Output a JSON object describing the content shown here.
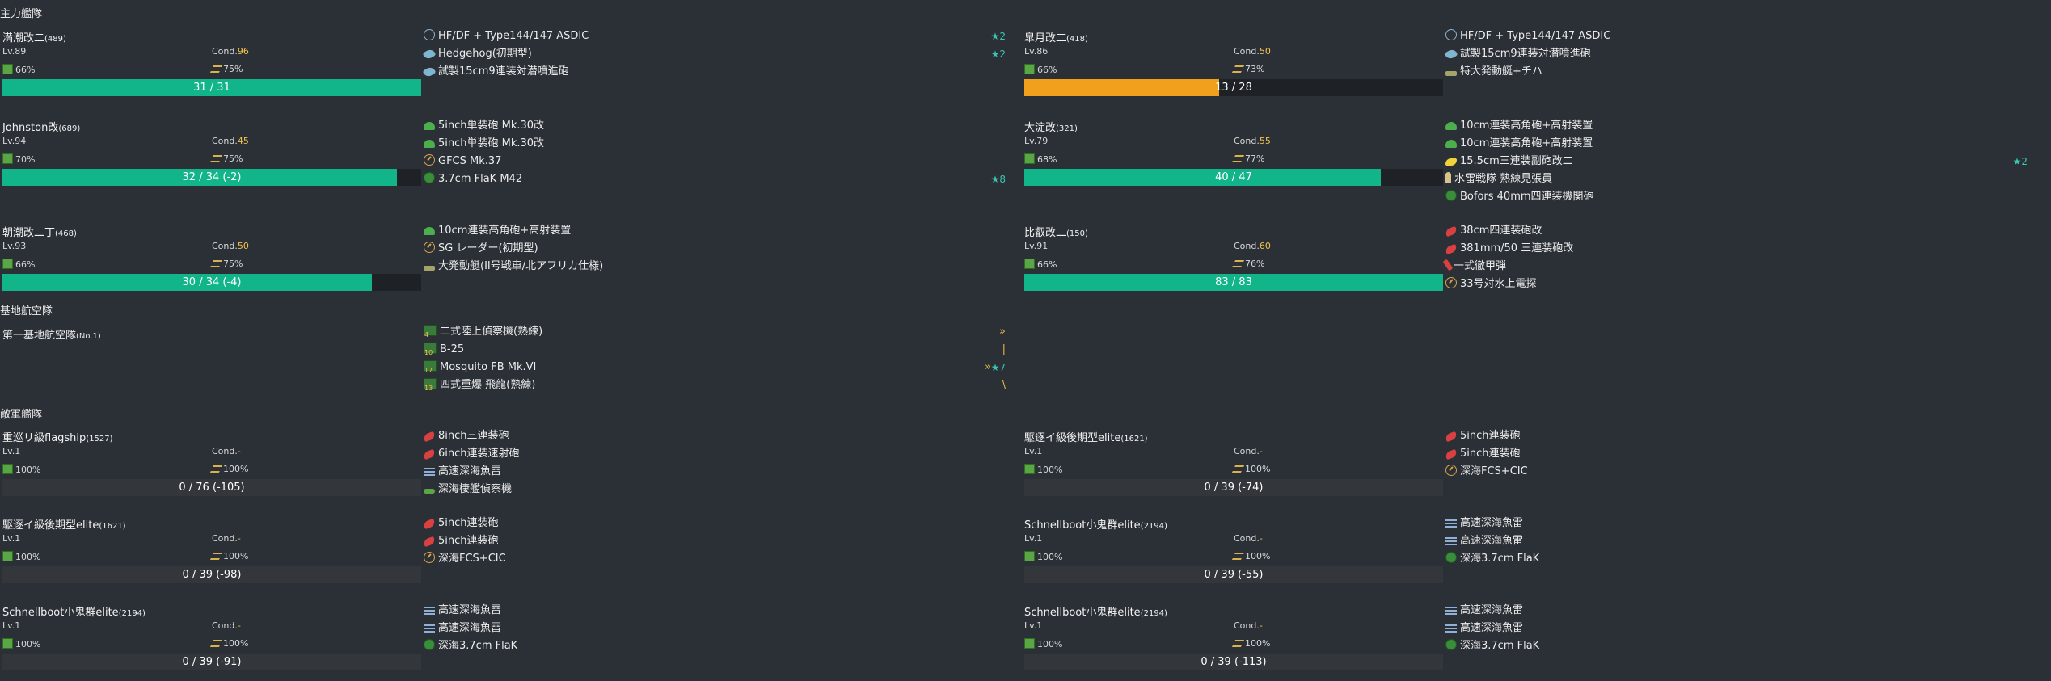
{
  "sections": {
    "main_fleet": "主力艦隊",
    "land_base": "基地航空隊",
    "enemy_fleet": "敵軍艦隊"
  },
  "colors": {
    "green": "#12b58a",
    "orange": "#f0a01c",
    "track": "#1e2125",
    "enemy_track": "#33373c"
  },
  "ships": [
    {
      "name": "満潮改二",
      "id": "(489)",
      "lv": "Lv.89",
      "cond_label": "Cond.",
      "cond": "96",
      "fuel": "66%",
      "ammo": "75%",
      "hp": "31 / 31",
      "hp_ratio": 1.0,
      "bar": "green",
      "equips": [
        {
          "icon": "sonar-icon",
          "name": "HF/DF + Type144/147 ASDIC",
          "imp": "★2"
        },
        {
          "icon": "depth-charge-icon",
          "name": "Hedgehog(初期型)",
          "imp": "★2"
        },
        {
          "icon": "depth-charge-icon",
          "name": "試製15cm9連装対潜噴進砲",
          "imp": ""
        }
      ]
    },
    {
      "name": "皐月改二",
      "id": "(418)",
      "lv": "Lv.86",
      "cond_label": "Cond.",
      "cond": "50",
      "fuel": "66%",
      "ammo": "73%",
      "hp": "13 / 28",
      "hp_ratio": 0.4643,
      "bar": "orange",
      "equips": [
        {
          "icon": "sonar-icon",
          "name": "HF/DF + Type144/147 ASDIC",
          "imp": ""
        },
        {
          "icon": "depth-charge-icon",
          "name": "試製15cm9連装対潜噴進砲",
          "imp": ""
        },
        {
          "icon": "landing-craft-icon",
          "name": "特大発動艇+チハ",
          "imp": ""
        }
      ]
    },
    {
      "name": "Johnston改",
      "id": "(689)",
      "lv": "Lv.94",
      "cond_label": "Cond.",
      "cond": "45",
      "fuel": "70%",
      "ammo": "75%",
      "hp": "32 / 34 (-2)",
      "hp_ratio": 0.9412,
      "bar": "green",
      "equips": [
        {
          "icon": "small-gun-icon",
          "name": "5inch単装砲 Mk.30改",
          "imp": ""
        },
        {
          "icon": "small-gun-icon",
          "name": "5inch単装砲 Mk.30改",
          "imp": ""
        },
        {
          "icon": "radar-icon",
          "name": "GFCS Mk.37",
          "imp": ""
        },
        {
          "icon": "aa-gun-icon",
          "name": "3.7cm FlaK M42",
          "imp": "★8"
        }
      ]
    },
    {
      "name": "大淀改",
      "id": "(321)",
      "lv": "Lv.79",
      "cond_label": "Cond.",
      "cond": "55",
      "fuel": "68%",
      "ammo": "77%",
      "hp": "40 / 47",
      "hp_ratio": 0.8511,
      "bar": "green",
      "equips": [
        {
          "icon": "small-gun-icon",
          "name": "10cm連装高角砲+高射装置",
          "imp": ""
        },
        {
          "icon": "small-gun-icon",
          "name": "10cm連装高角砲+高射装置",
          "imp": ""
        },
        {
          "icon": "secondary-gun-icon",
          "name": "15.5cm三連装副砲改二",
          "imp": "★2"
        },
        {
          "icon": "lookout-icon",
          "name": "水雷戦隊 熟練見張員",
          "imp": ""
        },
        {
          "icon": "aa-gun-icon",
          "name": "Bofors 40mm四連装機関砲",
          "imp": ""
        }
      ]
    },
    {
      "name": "朝潮改二丁",
      "id": "(468)",
      "lv": "Lv.93",
      "cond_label": "Cond.",
      "cond": "50",
      "fuel": "66%",
      "ammo": "75%",
      "hp": "30 / 34 (-4)",
      "hp_ratio": 0.8824,
      "bar": "green",
      "equips": [
        {
          "icon": "small-gun-icon",
          "name": "10cm連装高角砲+高射装置",
          "imp": ""
        },
        {
          "icon": "radar-icon",
          "name": "SG レーダー(初期型)",
          "imp": ""
        },
        {
          "icon": "landing-craft-icon",
          "name": "大発動艇(II号戦車/北アフリカ仕様)",
          "imp": ""
        }
      ]
    },
    {
      "name": "比叡改二",
      "id": "(150)",
      "lv": "Lv.91",
      "cond_label": "Cond.",
      "cond": "60",
      "fuel": "66%",
      "ammo": "76%",
      "hp": "83 / 83",
      "hp_ratio": 1.0,
      "bar": "green",
      "equips": [
        {
          "icon": "large-gun-icon",
          "name": "38cm四連装砲改",
          "imp": ""
        },
        {
          "icon": "large-gun-icon",
          "name": "381mm/50 三連装砲改",
          "imp": ""
        },
        {
          "icon": "ap-shell-icon",
          "name": "一式徹甲弾",
          "imp": ""
        },
        {
          "icon": "radar-icon",
          "name": "33号対水上電探",
          "imp": ""
        }
      ]
    }
  ],
  "land_base": {
    "name": "第一基地航空隊",
    "id": "(No.1)",
    "planes": [
      {
        "count": "4",
        "name": "二式陸上偵察機(熟練)",
        "prof": "»",
        "imp": ""
      },
      {
        "count": "10",
        "name": "B-25",
        "prof": "|",
        "imp": ""
      },
      {
        "count": "17",
        "name": "Mosquito FB Mk.VI",
        "prof": "»",
        "imp": "★7"
      },
      {
        "count": "13",
        "name": "四式重爆 飛龍(熟練)",
        "prof": "\\",
        "imp": ""
      }
    ]
  },
  "enemies": [
    {
      "name": "重巡リ級flagship",
      "id": "(1527)",
      "lv": "Lv.1",
      "cond_label": "Cond.",
      "cond": "-",
      "fuel": "100%",
      "ammo": "100%",
      "hp": "0 / 76 (-105)",
      "equips": [
        {
          "icon": "large-gun-icon",
          "name": "8inch三連装砲"
        },
        {
          "icon": "large-gun-icon",
          "name": "6inch連装速射砲"
        },
        {
          "icon": "torpedo-icon",
          "name": "高速深海魚雷"
        },
        {
          "icon": "seaplane-icon",
          "name": "深海棲艦偵察機"
        }
      ]
    },
    {
      "name": "駆逐イ級後期型elite",
      "id": "(1621)",
      "lv": "Lv.1",
      "cond_label": "Cond.",
      "cond": "-",
      "fuel": "100%",
      "ammo": "100%",
      "hp": "0 / 39 (-74)",
      "equips": [
        {
          "icon": "small-red-gun-icon",
          "name": "5inch連装砲"
        },
        {
          "icon": "small-red-gun-icon",
          "name": "5inch連装砲"
        },
        {
          "icon": "radar-icon",
          "name": "深海FCS+CIC"
        }
      ]
    },
    {
      "name": "駆逐イ級後期型elite",
      "id": "(1621)",
      "lv": "Lv.1",
      "cond_label": "Cond.",
      "cond": "-",
      "fuel": "100%",
      "ammo": "100%",
      "hp": "0 / 39 (-98)",
      "equips": [
        {
          "icon": "small-red-gun-icon",
          "name": "5inch連装砲"
        },
        {
          "icon": "small-red-gun-icon",
          "name": "5inch連装砲"
        },
        {
          "icon": "radar-icon",
          "name": "深海FCS+CIC"
        }
      ]
    },
    {
      "name": "Schnellboot小鬼群elite",
      "id": "(2194)",
      "lv": "Lv.1",
      "cond_label": "Cond.",
      "cond": "-",
      "fuel": "100%",
      "ammo": "100%",
      "hp": "0 / 39 (-55)",
      "equips": [
        {
          "icon": "torpedo-icon",
          "name": "高速深海魚雷"
        },
        {
          "icon": "torpedo-icon",
          "name": "高速深海魚雷"
        },
        {
          "icon": "aa-gun-icon",
          "name": "深海3.7cm FlaK"
        }
      ]
    },
    {
      "name": "Schnellboot小鬼群elite",
      "id": "(2194)",
      "lv": "Lv.1",
      "cond_label": "Cond.",
      "cond": "-",
      "fuel": "100%",
      "ammo": "100%",
      "hp": "0 / 39 (-91)",
      "equips": [
        {
          "icon": "torpedo-icon",
          "name": "高速深海魚雷"
        },
        {
          "icon": "torpedo-icon",
          "name": "高速深海魚雷"
        },
        {
          "icon": "aa-gun-icon",
          "name": "深海3.7cm FlaK"
        }
      ]
    },
    {
      "name": "Schnellboot小鬼群elite",
      "id": "(2194)",
      "lv": "Lv.1",
      "cond_label": "Cond.",
      "cond": "-",
      "fuel": "100%",
      "ammo": "100%",
      "hp": "0 / 39 (-113)",
      "equips": [
        {
          "icon": "torpedo-icon",
          "name": "高速深海魚雷"
        },
        {
          "icon": "torpedo-icon",
          "name": "高速深海魚雷"
        },
        {
          "icon": "aa-gun-icon",
          "name": "深海3.7cm FlaK"
        }
      ]
    }
  ]
}
